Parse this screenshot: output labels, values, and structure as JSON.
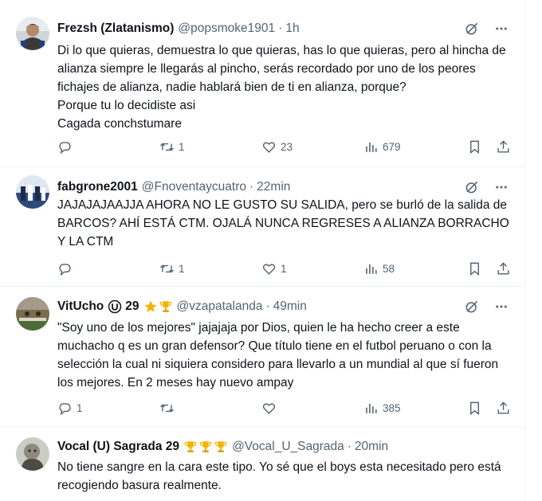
{
  "tweets": [
    {
      "name": "Frezsh (Zlatanismo)",
      "handle": "@popsmoke1901",
      "separator": "·",
      "time": "1h",
      "text": "Di lo que quieras, demuestra lo que quieras, has lo que quieras, pero al hincha de alianza siempre le llegarás al pincho, serás recordado por uno de los peores fichajes de alianza, nadie hablará bien de ti en alianza, porque?\nPorque tu lo decidiste asi\nCagada conchstumare",
      "replies": "",
      "reposts": "1",
      "likes": "23",
      "views": "679"
    },
    {
      "name": "fabgrone2001",
      "handle": "@Fnoventaycuatro",
      "separator": "·",
      "time": "22min",
      "text": "JAJAJAJAAJJA AHORA NO LE GUSTO SU SALIDA, pero se burló de la salida de BARCOS? AHÍ ESTÁ CTM. OJALÁ NUNCA REGRESES A ALIANZA BORRACHO Y LA CTM",
      "replies": "",
      "reposts": "1",
      "likes": "1",
      "views": "58"
    },
    {
      "name": "VitUcho",
      "name_badge": "29",
      "handle": "@vzapatalanda",
      "separator": "·",
      "time": "49min",
      "text": "\"Soy uno de los mejores\" jajajaja por Dios, quien le ha hecho creer a este muchacho q es un gran defensor? Que título tiene en el futbol peruano o con la selección la cual ni siquiera considero para llevarlo a un mundial al que sí fueron los mejores. En 2 meses hay nuevo ampay",
      "replies": "1",
      "reposts": "",
      "likes": "",
      "views": "385"
    },
    {
      "name": "Vocal (U) Sagrada 29",
      "handle": "@Vocal_U_Sagrada",
      "separator": "·",
      "time": "20min",
      "text": "No tiene sangre en la cara este tipo. Yo sé que el boys esta necesitado pero está recogiendo basura realmente."
    }
  ],
  "colors": {
    "text": "#0f1419",
    "secondary": "#536471",
    "border": "#eff3f4",
    "gold": "#f4b400"
  },
  "icons": [
    "grok-icon",
    "more-icon",
    "reply-icon",
    "repost-icon",
    "like-icon",
    "views-icon",
    "bookmark-icon",
    "share-icon",
    "u-club-icon",
    "star-icon",
    "trophy-icon"
  ]
}
